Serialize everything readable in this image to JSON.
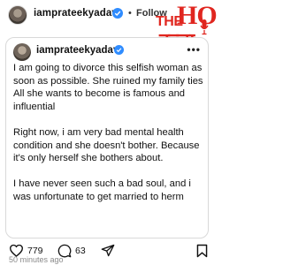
{
  "header": {
    "username": "iamprateekyadav",
    "separator": "•",
    "follow_label": "Follow"
  },
  "watermark": {
    "the": "THE",
    "ho": "HO",
    "hindi": "हल्ला"
  },
  "post": {
    "username": "iamprateekyadav",
    "more_label": "•••",
    "paragraphs": [
      "I am going to divorce this selfish woman as soon as possible. She ruined my family ties All she wants to become is famous and influential",
      "Right now, i am very bad mental health condition and she doesn't bother. Because it's only herself she bothers about.",
      "I have never seen such a bad soul, and i was unfortunate to get married to herm"
    ]
  },
  "actions": {
    "likes": "779",
    "comments": "63"
  },
  "timestamp": "50 minutes ago"
}
